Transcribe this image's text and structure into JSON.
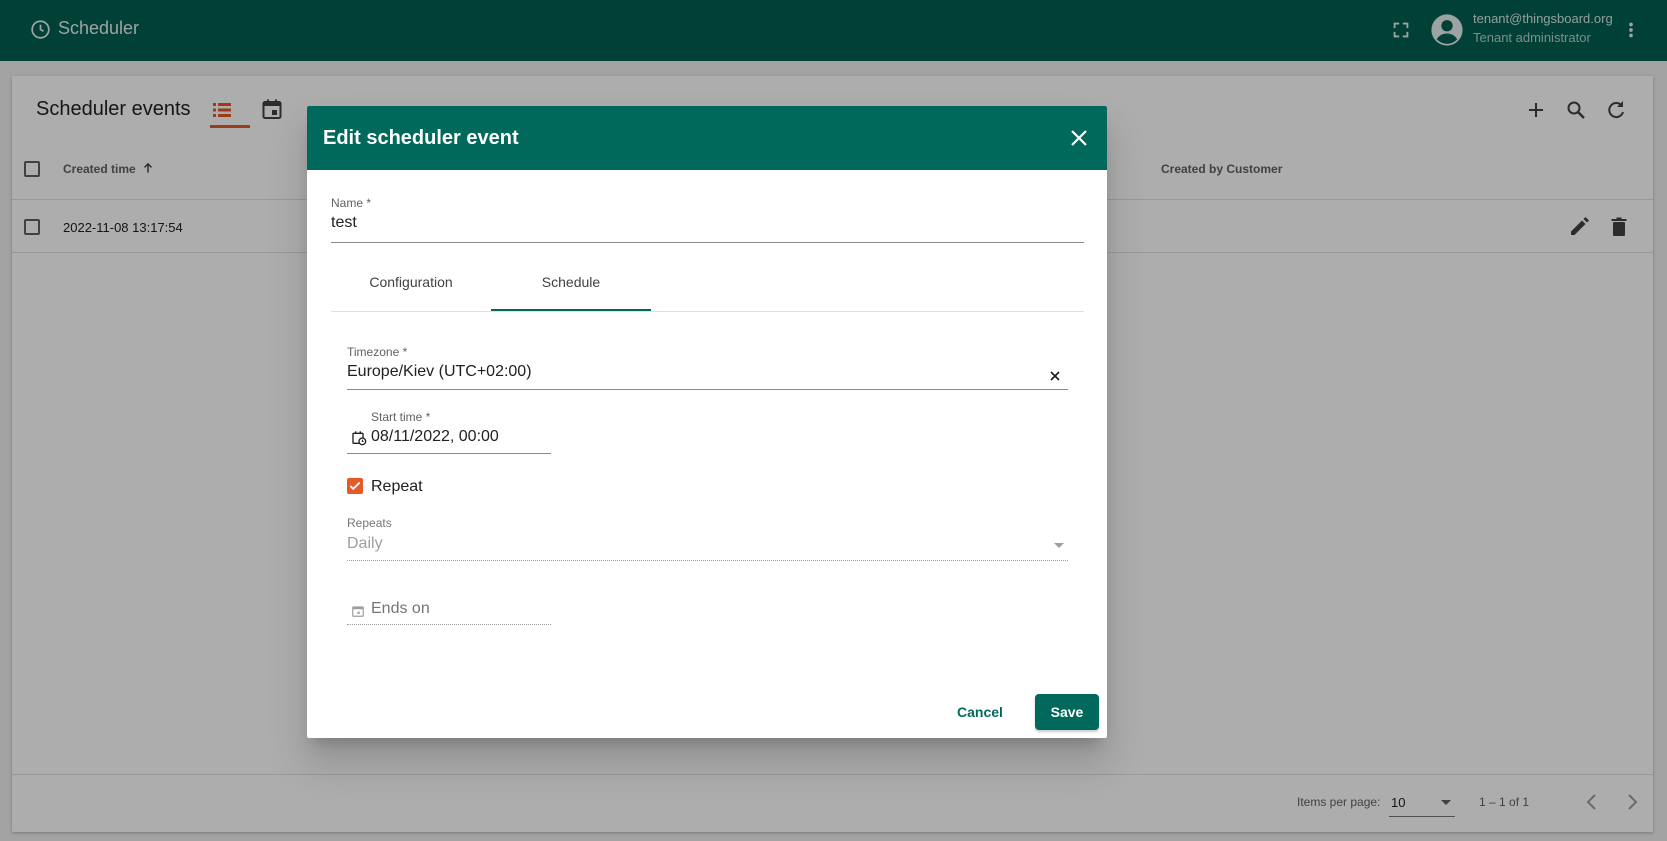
{
  "app": {
    "title": "Scheduler",
    "user_email": "tenant@thingsboard.org",
    "user_role": "Tenant administrator"
  },
  "page": {
    "title": "Scheduler events",
    "columns": [
      "Created time",
      "Created by Customer"
    ],
    "rows": [
      {
        "created_time": "2022-11-08 13:17:54"
      }
    ],
    "pager": {
      "items_per_page_label": "Items per page:",
      "items_per_page_value": "10",
      "range": "1 – 1 of 1"
    }
  },
  "dialog": {
    "title": "Edit scheduler event",
    "name_label": "Name *",
    "name_value": "test",
    "tabs": [
      "Configuration",
      "Schedule"
    ],
    "active_tab": "Schedule",
    "timezone_label": "Timezone *",
    "timezone_value": "Europe/Kiev (UTC+02:00)",
    "start_label": "Start time *",
    "start_value": "08/11/2022, 00:00",
    "repeat_label": "Repeat",
    "repeat_checked": true,
    "repeats_label": "Repeats",
    "repeats_value": "Daily",
    "ends_on_placeholder": "Ends on",
    "cancel_label": "Cancel",
    "save_label": "Save"
  },
  "colors": {
    "primary": "#005f52",
    "dialog_header": "#00695c",
    "accent": "#e65a27"
  },
  "icons": [
    "clock-icon",
    "fullscreen-icon",
    "account-circle-icon",
    "more-vert-icon",
    "list-icon",
    "calendar-icon",
    "add-icon",
    "search-icon",
    "refresh-icon",
    "edit-icon",
    "delete-icon",
    "close-icon",
    "chevron-left-icon",
    "chevron-right-icon"
  ]
}
